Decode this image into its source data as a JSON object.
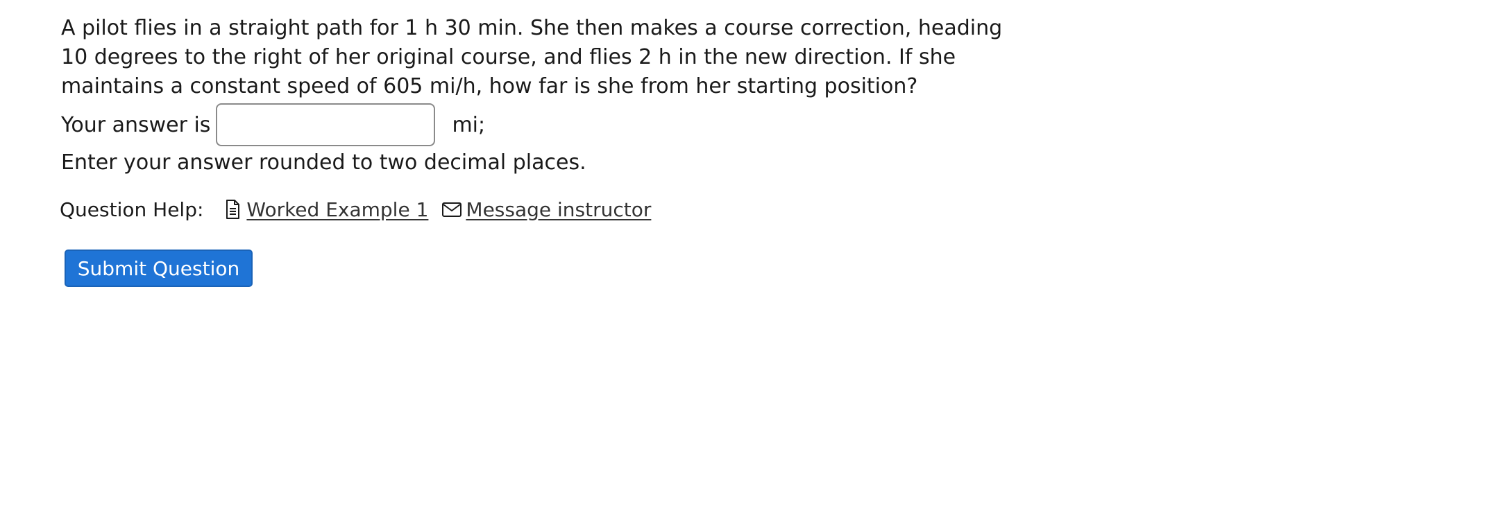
{
  "question": {
    "text": "A pilot flies in a straight path for 1 h 30 min. She then makes a course correction, heading 10 degrees to the right of her original course, and flies 2 h in the new direction. If she maintains a constant speed of 605 mi/h, how far is she from her starting position?"
  },
  "answer": {
    "prefix": "Your answer is",
    "value": "",
    "unit": "mi;"
  },
  "instructions": {
    "rounding_note": "Enter your answer rounded to two decimal places."
  },
  "help": {
    "label": "Question Help:",
    "links": [
      {
        "label": " Worked Example 1",
        "icon": "document-icon"
      },
      {
        "label": " Message instructor",
        "icon": "envelope-icon"
      }
    ]
  },
  "actions": {
    "submit_label": "Submit Question"
  },
  "colors": {
    "accent": "#1f74d6",
    "text": "#1a1a1a",
    "link": "#333333"
  }
}
